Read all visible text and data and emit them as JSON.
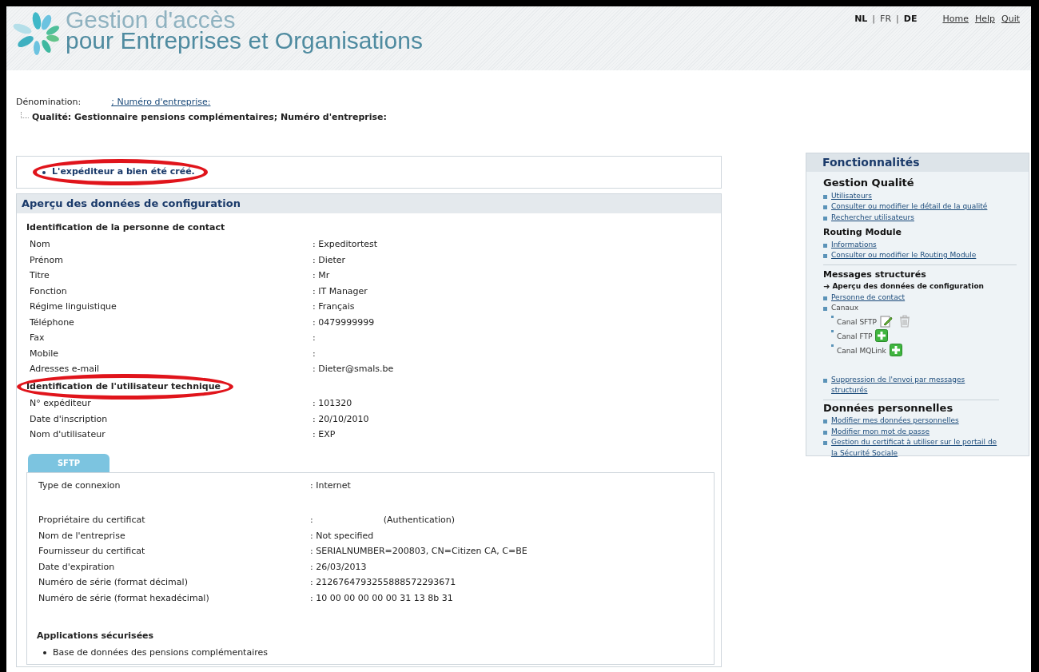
{
  "header": {
    "title_line_1": "Gestion d'accès",
    "title_line_2": "pour Entreprises et Organisations",
    "languages": [
      {
        "label": "NL",
        "selected": false
      },
      {
        "label": "FR",
        "selected": true
      },
      {
        "label": "DE",
        "selected": false
      }
    ],
    "language_separator": "|",
    "links": [
      "Home",
      "Help",
      "Quit"
    ]
  },
  "company": {
    "label": "Dénomination:",
    "link": "; Numéro d'entreprise:",
    "quality": "Qualité: Gestionnaire pensions complémentaires; Numéro d'entreprise:"
  },
  "message": {
    "text": "L'expéditeur a bien été créé.",
    "highlighted": true
  },
  "config": {
    "title": "Aperçu des données de configuration",
    "sections": [
      {
        "title": "Identification de la personne de contact",
        "highlighted": false,
        "rows": [
          {
            "label": "Nom",
            "value": ": Expeditortest"
          },
          {
            "label": "Prénom",
            "value": ": Dieter"
          },
          {
            "label": "Titre",
            "value": ": Mr"
          },
          {
            "label": "Fonction",
            "value": ": IT Manager"
          },
          {
            "label": "Régime linguistique",
            "value": ": Français"
          },
          {
            "label": "Téléphone",
            "value": ": 0479999999"
          },
          {
            "label": "Fax",
            "value": ":"
          },
          {
            "label": "Mobile",
            "value": ":"
          },
          {
            "label": "Adresses e-mail",
            "value": ": Dieter@smals.be"
          }
        ]
      },
      {
        "title": "Identification de l'utilisateur technique",
        "highlighted": true,
        "rows": [
          {
            "label": "N° expéditeur",
            "value": ": 101320"
          },
          {
            "label": "Date d'inscription",
            "value": ": 20/10/2010"
          },
          {
            "label": "Nom d'utilisateur",
            "value": ": EXP"
          }
        ]
      }
    ],
    "tab": {
      "label": "SFTP",
      "selected": true
    },
    "channel_groups": [
      {
        "rows": [
          {
            "label": "Type de connexion",
            "value": ": Internet"
          }
        ]
      },
      {
        "rows": [
          {
            "label": "Propriétaire du certificat",
            "value": ":",
            "value_2": "(Authentication)"
          },
          {
            "label": "Nom de l'entreprise",
            "value": ": Not specified"
          },
          {
            "label": "Fournisseur du certificat",
            "value": ": SERIALNUMBER=200803, CN=Citizen CA, C=BE"
          },
          {
            "label": "Date d'expiration",
            "value": ": 26/03/2013"
          },
          {
            "label": "Numéro de série (format décimal)",
            "value": ": 2126764793255888572293671"
          },
          {
            "label": "Numéro de série (format hexadécimal)",
            "value": ": 10 00 00 00 00 00 31 13 8b 31"
          }
        ]
      }
    ],
    "applications": {
      "title": "Applications sécurisées",
      "items": [
        "Base de données des pensions complémentaires"
      ]
    }
  },
  "sidebar": {
    "title": "Fonctionnalités",
    "sections": [
      {
        "title": "Gestion Qualité",
        "large": true,
        "items": [
          {
            "kind": "link",
            "label": "Utilisateurs"
          },
          {
            "kind": "link",
            "label": "Consulter ou modifier le détail de la qualité"
          },
          {
            "kind": "link",
            "label": "Rechercher utilisateurs"
          }
        ]
      },
      {
        "title": "Routing Module",
        "large": false,
        "items": [
          {
            "kind": "link",
            "label": "Informations"
          },
          {
            "kind": "link",
            "label": "Consulter ou modifier le Routing Module"
          }
        ]
      },
      {
        "title": "Messages structurés",
        "large": false,
        "items": [
          {
            "kind": "current",
            "marker": "➜",
            "label": "Aperçu des données de configuration"
          },
          {
            "kind": "link",
            "label": "Personne de contact"
          },
          {
            "kind": "text",
            "label": "Canaux",
            "children": [
              {
                "label": "Canal SFTP",
                "kind": "edit"
              },
              {
                "label": "Canal FTP",
                "kind": "add"
              },
              {
                "label": "Canal MQLink",
                "kind": "add"
              }
            ]
          },
          {
            "kind": "spacer-link",
            "label": "Suppression de l'envoi par messages structurés"
          }
        ]
      },
      {
        "title": "Données personnelles",
        "large": true,
        "items": [
          {
            "kind": "link",
            "label": "Modifier mes données personnelles"
          },
          {
            "kind": "link",
            "label": "Modifier mon mot de passe"
          },
          {
            "kind": "link",
            "label": "Gestion du certificat à utiliser sur le portail de la Sécurité Sociale"
          }
        ]
      }
    ]
  }
}
